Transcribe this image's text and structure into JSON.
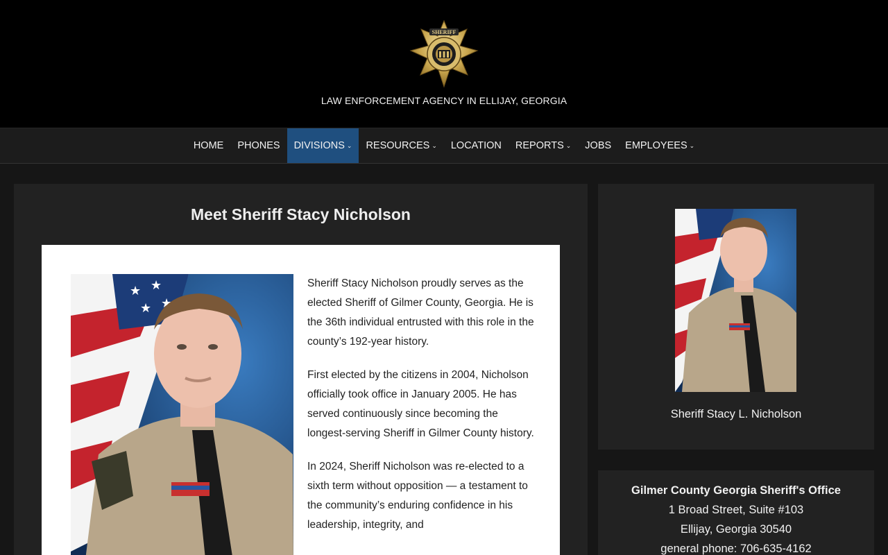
{
  "header": {
    "logo_icon": "sheriff-star-badge-icon",
    "tagline": "LAW ENFORCEMENT AGENCY IN ELLIJAY, GEORGIA"
  },
  "nav": {
    "items": [
      {
        "label": "HOME",
        "dropdown": false
      },
      {
        "label": "PHONES",
        "dropdown": false
      },
      {
        "label": "DIVISIONS",
        "dropdown": true,
        "active": true
      },
      {
        "label": "RESOURCES",
        "dropdown": true
      },
      {
        "label": "LOCATION",
        "dropdown": false
      },
      {
        "label": "REPORTS",
        "dropdown": true
      },
      {
        "label": "JOBS",
        "dropdown": false
      },
      {
        "label": "EMPLOYEES",
        "dropdown": true
      }
    ],
    "chevron": "⌄",
    "active_color": "#1f4f7f"
  },
  "main": {
    "title": "Meet Sheriff Stacy Nicholson",
    "paragraphs": [
      "Sheriff Stacy Nicholson proudly serves as the elected Sheriff of Gilmer County, Georgia. He is the 36th individual entrusted with this role in the county’s 192-year history.",
      "First elected by the citizens in 2004, Nicholson officially took office in January 2005. He has served continuously since becoming the longest-serving Sheriff in Gilmer County history.",
      "In 2024, Sheriff Nicholson was re-elected to a sixth term without opposition — a testament to the community’s enduring confidence in his leadership, integrity, and"
    ]
  },
  "sidebar": {
    "caption": "Sheriff Stacy L. Nicholson",
    "contact": {
      "org": "Gilmer County Georgia Sheriff's Office",
      "street": "1 Broad Street, Suite #103",
      "city": "Ellijay, Georgia 30540",
      "phone": "general phone: 706-635-4162"
    }
  }
}
